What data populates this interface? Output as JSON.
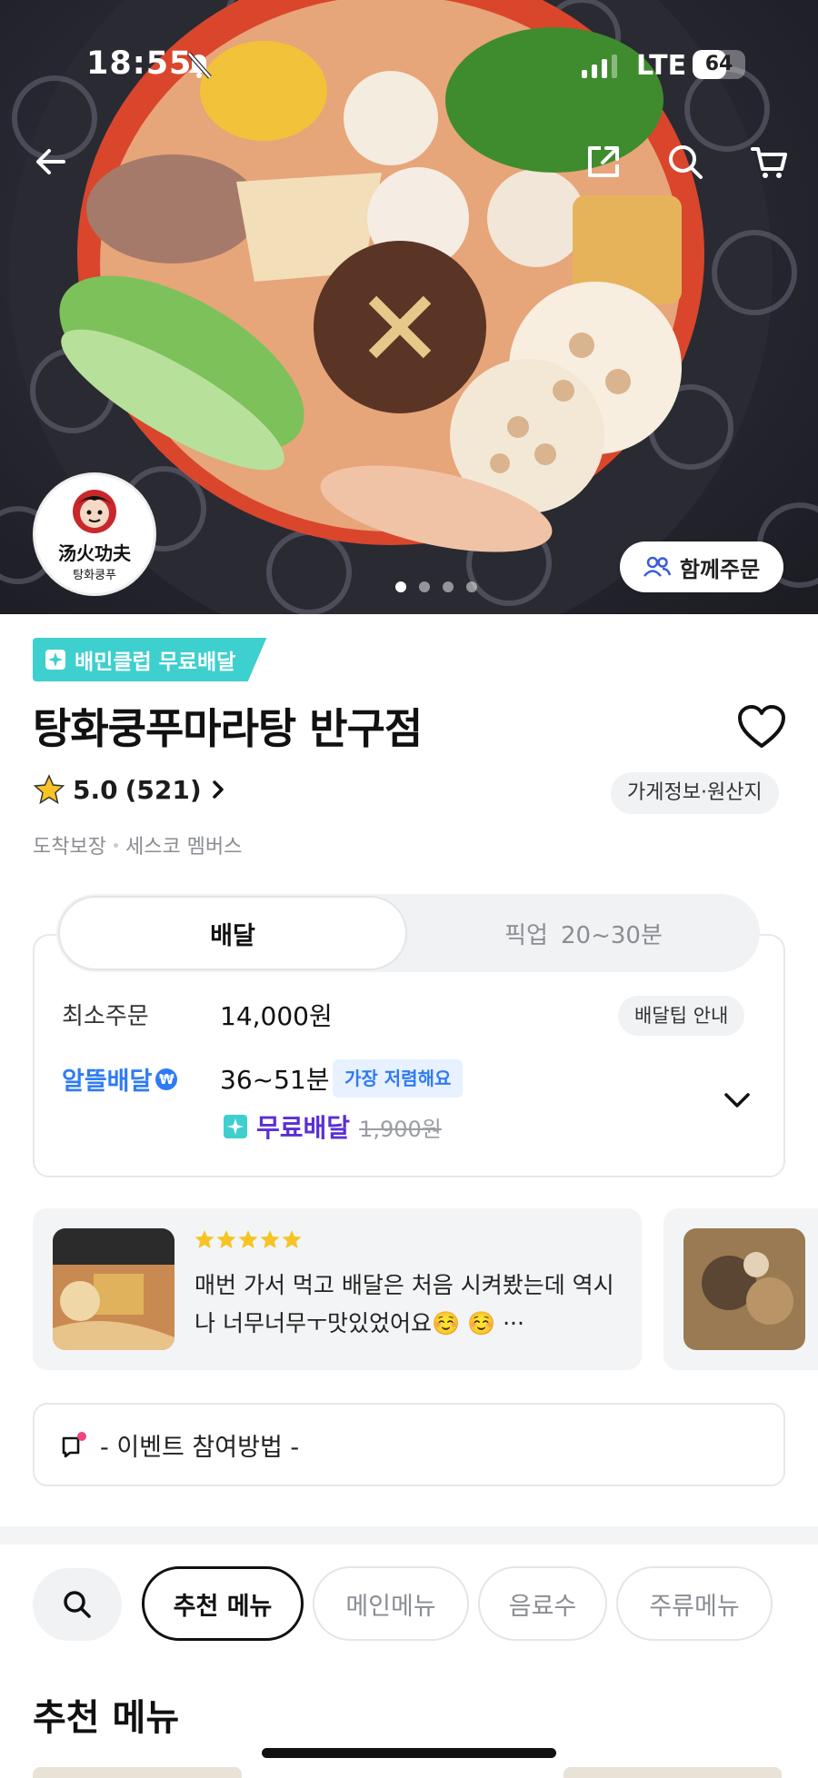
{
  "status_bar": {
    "time": "18:55",
    "network": "LTE",
    "battery": "64",
    "battery_level": 0.64
  },
  "hero": {
    "together_order_label": "함께주문",
    "logo_chinese": "汤火功夫",
    "logo_korean": "탕화쿵푸",
    "page_dots_count": 4,
    "active_dot": 0
  },
  "store": {
    "club_badge": "배민클럽 무료배달",
    "name": "탕화쿵푸마라탕 반구점",
    "rating": "5.0",
    "review_count": "(521)",
    "info_button": "가게정보·원산지",
    "tags": [
      "도착보장",
      "세스코 멤버스"
    ]
  },
  "order_mode": {
    "delivery_tab": "배달",
    "pickup_tab": "픽업",
    "pickup_time": "20~30분"
  },
  "delivery": {
    "min_order_label": "최소주문",
    "min_order_value": "14,000원",
    "tip_button": "배달팁 안내",
    "service_label": "알뜰배달",
    "eta": "36~51분",
    "cheapest_badge": "가장 저렴해요",
    "free_delivery": "무료배달",
    "original_fee": "1,900원"
  },
  "review": {
    "stars": 5,
    "text": "매번 가서 먹고 배달은 처음 시켜봤는데 역시나 너무너무ㅜ맛있었어요☺️ ☺️ ···"
  },
  "event": {
    "label": "- 이벤트 참여방법 -"
  },
  "menu_tabs": [
    {
      "label": "추천 메뉴",
      "active": true
    },
    {
      "label": "메인메뉴",
      "active": false
    },
    {
      "label": "음료수",
      "active": false
    },
    {
      "label": "주류메뉴",
      "active": false
    }
  ],
  "section_title": "추천 메뉴",
  "colors": {
    "club_teal": "#3ecfcf",
    "altteul_blue": "#2f7bf5",
    "free_purple": "#5a2fd6",
    "star_yellow": "#f7c325"
  }
}
